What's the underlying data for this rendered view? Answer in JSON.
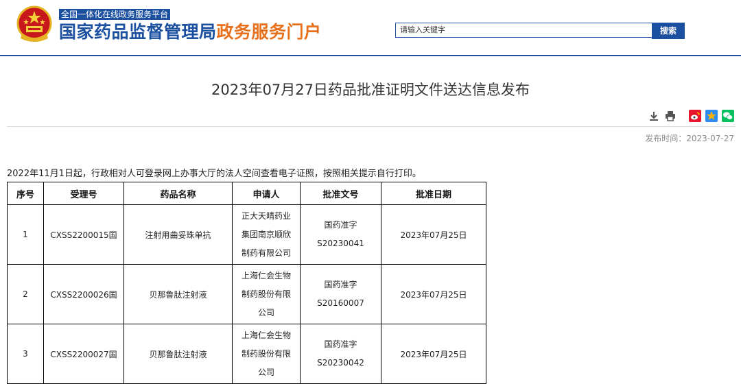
{
  "header": {
    "platform_tag": "全国一体化在线政务服务平台",
    "title_blue": "国家药品监督管理局",
    "title_orange": "政务服务门户",
    "search_placeholder": "请输入关键字",
    "search_button": "搜索"
  },
  "article": {
    "title": "2023年07月27日药品批准证明文件送达信息发布",
    "publish_label": "发布时间：",
    "publish_date": "2023-07-27",
    "notice": "2022年11月1日起，行政相对人可登录网上办事大厅的法人空间查看电子证照，按照相关提示自行打印。"
  },
  "toolbar": {
    "icons": [
      "download-icon",
      "print-icon",
      "weibo-icon",
      "qzone-icon",
      "wechat-icon"
    ],
    "colors": {
      "weibo": "#e6162d",
      "qzone": "#f4b400",
      "wechat": "#07c160"
    }
  },
  "table": {
    "headers": [
      "序号",
      "受理号",
      "药品名称",
      "申请人",
      "批准文号",
      "批准日期"
    ],
    "rows": [
      {
        "no": "1",
        "accept_no": "CXSS2200015国",
        "drug": "注射用曲妥珠单抗",
        "applicant": [
          "正大天晴药业",
          "集团南京顺欣",
          "制药有限公司"
        ],
        "approval": [
          "国药准字",
          "S20230041"
        ],
        "date": "2023年07月25日"
      },
      {
        "no": "2",
        "accept_no": "CXSS2200026国",
        "drug": "贝那鲁肽注射液",
        "applicant": [
          "上海仁会生物",
          "制药股份有限",
          "公司"
        ],
        "approval": [
          "国药准字",
          "S20160007"
        ],
        "date": "2023年07月25日"
      },
      {
        "no": "3",
        "accept_no": "CXSS2200027国",
        "drug": "贝那鲁肽注射液",
        "applicant": [
          "上海仁会生物",
          "制药股份有限",
          "公司"
        ],
        "approval": [
          "国药准字",
          "S20230042"
        ],
        "date": "2023年07月25日"
      }
    ]
  },
  "colors": {
    "brand_blue": "#1b4fa0",
    "brand_orange": "#e8701a"
  }
}
